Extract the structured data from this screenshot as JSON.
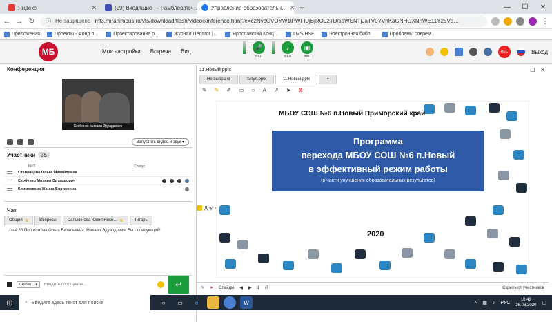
{
  "browser": {
    "tabs": [
      {
        "label": "Яндекс",
        "icon": "yandex-icon",
        "color": "#e53935"
      },
      {
        "label": "(29) Входящие — Рамблер/поч…",
        "icon": "mail-icon",
        "color": "#3f51b5"
      },
      {
        "label": "Управление образовательн…",
        "icon": "chrome-icon",
        "color": "#1a73e8"
      }
    ],
    "new_tab": "+",
    "not_secure": "Не защищено",
    "url": "mf3.miranimbus.ru/vfs/download/flash/videoconference.html?e=c2NvcGVOYW1lPWFlUjBjRO92TD/seWSNTjJaTV0YVhKaGNHOXNhWE11Y25Vd…",
    "bookmarks": [
      "Приложения",
      "Проекты - Фонд п…",
      "Проектирование р…",
      "Журнал Педагог |…",
      "Ярославский Конц…",
      "LMS HSE",
      "Электронная библ…",
      "Проблемы соврем…"
    ],
    "other_bookmarks": "Другие закладки"
  },
  "app": {
    "logo": "МБ",
    "menu": [
      "Мои настройки",
      "Встреча",
      "Вид"
    ],
    "ctrl_label": "ВКЛ",
    "rec_label": "REC",
    "exit": "Выход"
  },
  "conference": {
    "title": "Конференция",
    "video_caption": "Скобенко Михаил Эдуардович",
    "start_button": "Запустить видео и звук"
  },
  "participants": {
    "title": "Участники",
    "count": "35",
    "col_name": "ФИО",
    "col_status": "Статус",
    "rows": [
      "Степанцева Ольга Михайловна",
      "Скобенко Михаил Эдуардович",
      "Клименкова Жанна Борисовна"
    ]
  },
  "chat": {
    "title": "Чат",
    "tabs": [
      "Общий",
      "Вопросы",
      "Салькинова Юлия Нико…",
      "Титарь"
    ],
    "message_time": "10:44:33",
    "message_text": "Пополитова Ольга Витальевна: Михаил Эдуардович! Вы - следующий!",
    "select": "Скобен…",
    "input_placeholder": "Введите сообщение…"
  },
  "document": {
    "title": "11.Новый.pptx",
    "tabs": [
      "Не выбрано",
      "титул.pptx",
      "11.Новый.pptx",
      "+"
    ],
    "slide_header": "МБОУ СОШ №6 п.Новый Приморский край",
    "slide_title_lines": [
      "Программа",
      "перехода МБОУ СОШ №6 п.Новый",
      "в эффективный режим работы"
    ],
    "slide_subtitle": "(в части улучшения образовательных результатов)",
    "slide_year": "2020",
    "slides_label": "Слайды",
    "page": "1",
    "total": "/7",
    "hide_label": "Скрыть от участников"
  },
  "taskbar": {
    "search": "Введите здесь текст для поиска",
    "lang": "РУС",
    "time": "10:49",
    "date": "26.06.2020"
  },
  "colors": {
    "green": "#1a9b3b",
    "blue": "#2e5aa8",
    "taskbar": "#1f2a38"
  }
}
